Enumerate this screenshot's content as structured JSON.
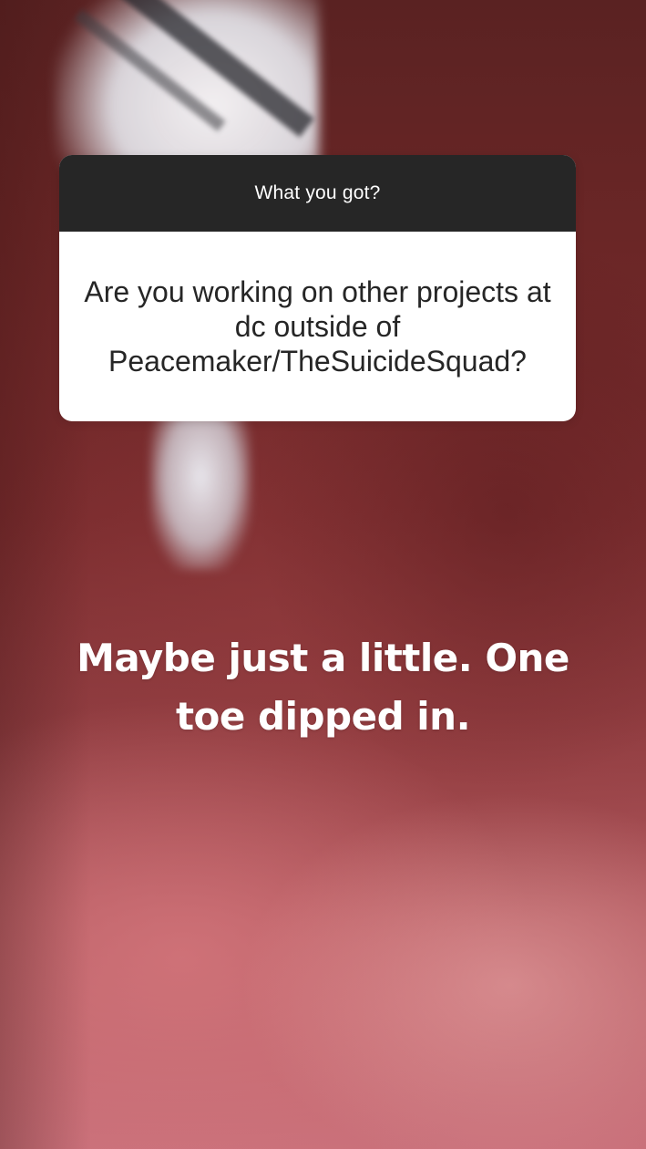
{
  "question_sticker": {
    "prompt": "What you got?",
    "question": "Are you working on other projects at dc outside of Peacemaker/TheSuicideSquad?"
  },
  "answer": {
    "text": "Maybe just a little. One toe dipped in."
  },
  "colors": {
    "sticker_header": "#262626",
    "sticker_body": "#ffffff",
    "answer_text": "#ffffff",
    "background": "#7a2c2e"
  }
}
